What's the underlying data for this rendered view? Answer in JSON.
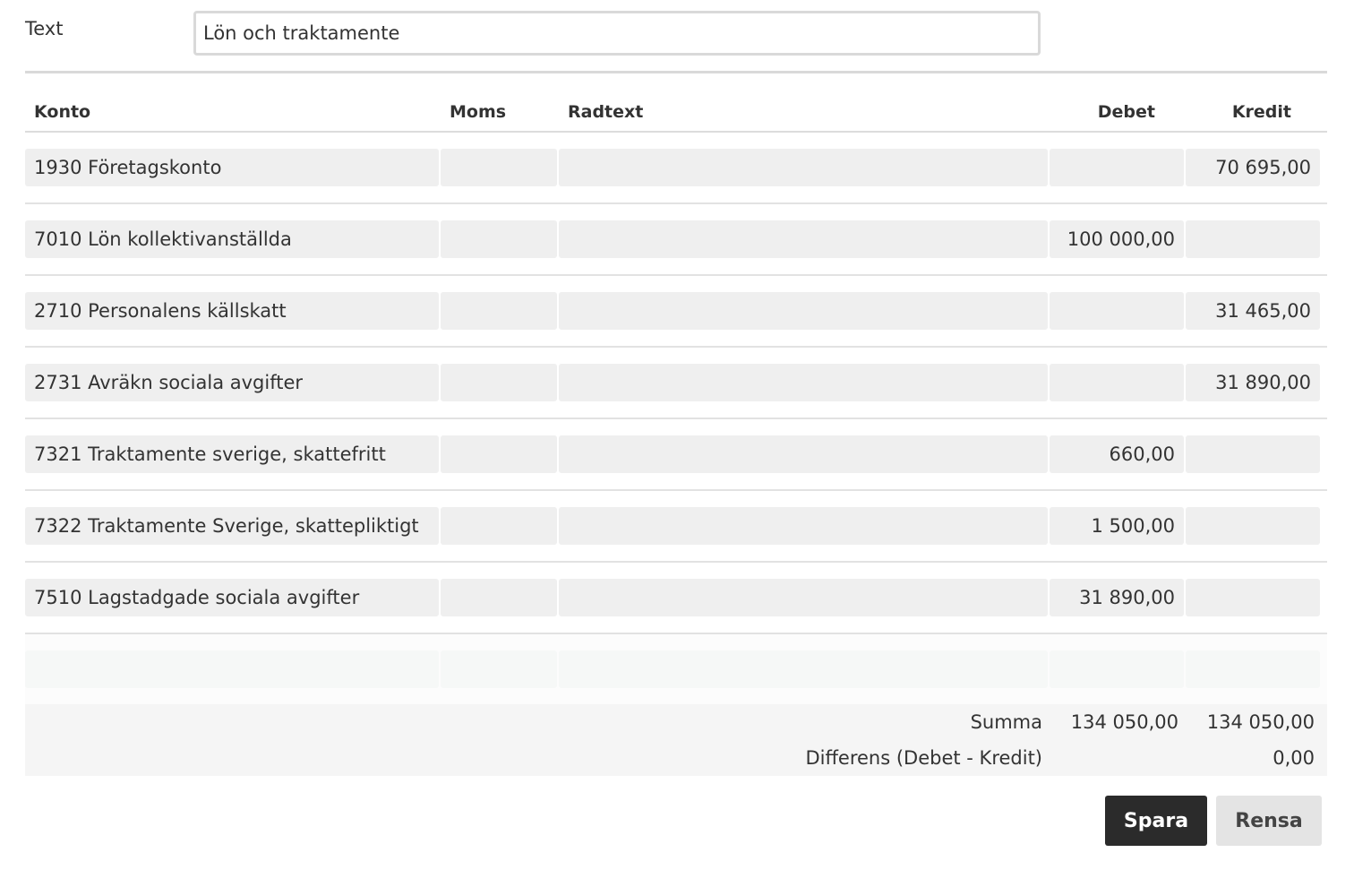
{
  "text_field": {
    "label": "Text",
    "value": "Lön och traktamente"
  },
  "table": {
    "headers": {
      "konto": "Konto",
      "moms": "Moms",
      "radtext": "Radtext",
      "debet": "Debet",
      "kredit": "Kredit"
    },
    "rows": [
      {
        "konto": "1930 Företagskonto",
        "moms": "",
        "radtext": "",
        "debet": "",
        "kredit": "70 695,00"
      },
      {
        "konto": "7010 Lön kollektivanställda",
        "moms": "",
        "radtext": "",
        "debet": "100 000,00",
        "kredit": ""
      },
      {
        "konto": "2710 Personalens källskatt",
        "moms": "",
        "radtext": "",
        "debet": "",
        "kredit": "31 465,00"
      },
      {
        "konto": "2731 Avräkn sociala avgifter",
        "moms": "",
        "radtext": "",
        "debet": "",
        "kredit": "31 890,00"
      },
      {
        "konto": "7321 Traktamente sverige, skattefritt",
        "moms": "",
        "radtext": "",
        "debet": "660,00",
        "kredit": ""
      },
      {
        "konto": "7322 Traktamente Sverige, skattepliktigt",
        "moms": "",
        "radtext": "",
        "debet": "1 500,00",
        "kredit": ""
      },
      {
        "konto": "7510 Lagstadgade sociala avgifter",
        "moms": "",
        "radtext": "",
        "debet": "31 890,00",
        "kredit": ""
      }
    ]
  },
  "summary": {
    "summa_label": "Summa",
    "summa_debet": "134 050,00",
    "summa_kredit": "134 050,00",
    "diff_label": "Differens (Debet - Kredit)",
    "diff_value": "0,00"
  },
  "buttons": {
    "save": "Spara",
    "clear": "Rensa"
  }
}
